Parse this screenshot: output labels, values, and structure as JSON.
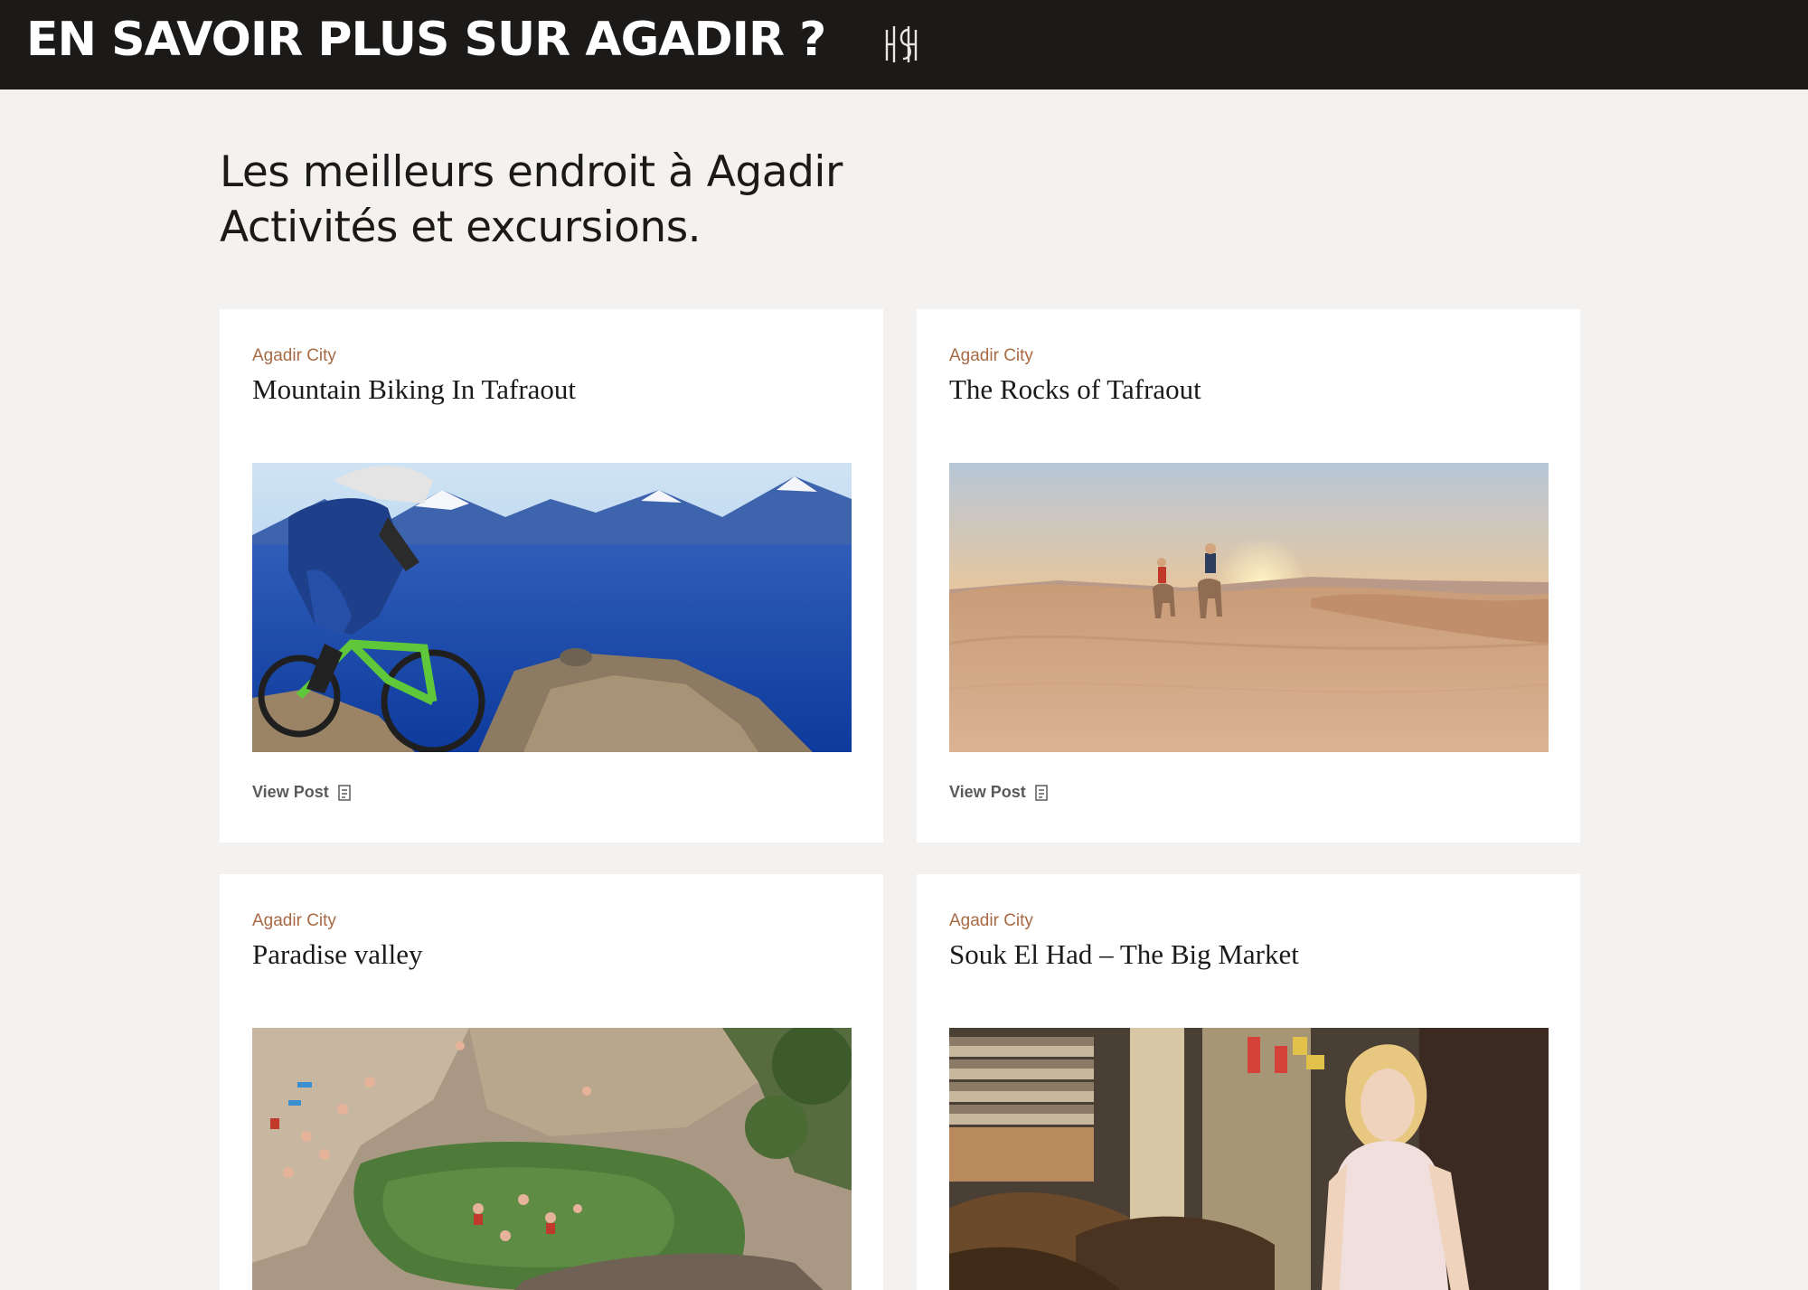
{
  "header": {
    "title": "EN SAVOIR PLUS SUR AGADIR ?",
    "logo_icon": "monogram-logo-icon",
    "background": "#1b1a19"
  },
  "heading": {
    "line1": "Les meilleurs endroit à Agadir",
    "line2": "Activités et excursions."
  },
  "colors": {
    "accent": "#a86a45",
    "page_background": "#f3f2f1",
    "card_background": "#ffffff"
  },
  "cards": [
    {
      "category": "Agadir City",
      "title": "Mountain Biking In Tafraout",
      "link_label": "View Post",
      "image": "mountain-biker-over-blue-valley"
    },
    {
      "category": "Agadir City",
      "title": "The Rocks of Tafraout",
      "link_label": "View Post",
      "image": "camel-riders-in-desert-dunes-at-sunset"
    },
    {
      "category": "Agadir City",
      "title": "Paradise valley",
      "link_label": "",
      "image": "swimmers-in-rocky-gorge-pool"
    },
    {
      "category": "Agadir City",
      "title": "Souk El Had – The Big Market",
      "link_label": "",
      "image": "woman-at-spice-market-stall"
    }
  ]
}
